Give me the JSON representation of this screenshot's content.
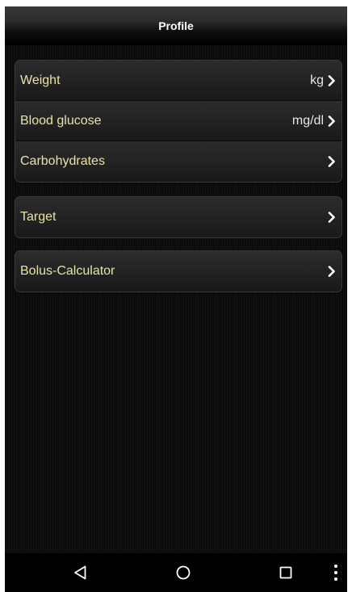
{
  "header": {
    "title": "Profile"
  },
  "groups": [
    {
      "rows": [
        {
          "label": "Weight",
          "unit": "kg"
        },
        {
          "label": "Blood glucose",
          "unit": "mg/dl"
        },
        {
          "label": "Carbohydrates",
          "unit": ""
        }
      ]
    },
    {
      "rows": [
        {
          "label": "Target",
          "unit": ""
        }
      ]
    },
    {
      "rows": [
        {
          "label": "Bolus-Calculator",
          "unit": ""
        }
      ]
    }
  ],
  "colors": {
    "label": "#e8e2a6",
    "unit": "#e6e6e6",
    "background": "#0a0a0a"
  },
  "icons": {
    "chevron": "chevron-right-icon",
    "nav_back": "back-triangle-icon",
    "nav_home": "home-circle-icon",
    "nav_recents": "recents-square-icon",
    "nav_menu": "overflow-menu-icon"
  }
}
